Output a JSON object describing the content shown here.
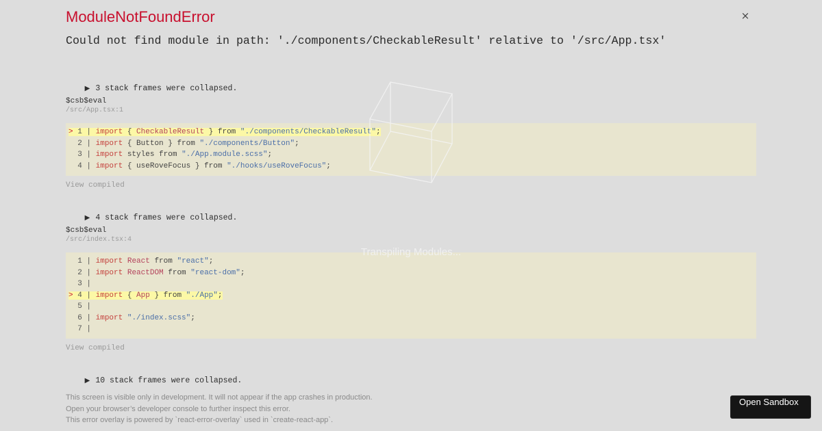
{
  "error": {
    "title": "ModuleNotFoundError",
    "close_label": "×",
    "message": "Could not find module in path: './components/CheckableResult' relative to '/src/App.tsx'"
  },
  "stack": {
    "collapsed_1": "3 stack frames were collapsed.",
    "collapsed_2": "4 stack frames were collapsed.",
    "collapsed_3": "10 stack frames were collapsed.",
    "collapse_icon": "triangle-right-icon",
    "frames": [
      {
        "function": "$csb$eval",
        "location": "/src/App.tsx:1",
        "view_compiled": "View compiled",
        "lines": [
          {
            "marker": ">",
            "num": "1",
            "highlight": true,
            "tokens": [
              [
                "kw",
                "import"
              ],
              [
                "plain",
                " { "
              ],
              [
                "id",
                "CheckableResult"
              ],
              [
                "plain",
                " } from "
              ],
              [
                "str",
                "\"./components/CheckableResult\""
              ],
              [
                "plain",
                ";"
              ]
            ]
          },
          {
            "marker": " ",
            "num": "2",
            "highlight": false,
            "tokens": [
              [
                "kw",
                "import"
              ],
              [
                "plain",
                " { Button } from "
              ],
              [
                "str",
                "\"./components/Button\""
              ],
              [
                "plain",
                ";"
              ]
            ]
          },
          {
            "marker": " ",
            "num": "3",
            "highlight": false,
            "tokens": [
              [
                "kw",
                "import"
              ],
              [
                "plain",
                " styles from "
              ],
              [
                "str",
                "\"./App.module.scss\""
              ],
              [
                "plain",
                ";"
              ]
            ]
          },
          {
            "marker": " ",
            "num": "4",
            "highlight": false,
            "tokens": [
              [
                "kw",
                "import"
              ],
              [
                "plain",
                " { useRoveFocus } from "
              ],
              [
                "str",
                "\"./hooks/useRoveFocus\""
              ],
              [
                "plain",
                ";"
              ]
            ]
          }
        ]
      },
      {
        "function": "$csb$eval",
        "location": "/src/index.tsx:4",
        "view_compiled": "View compiled",
        "lines": [
          {
            "marker": " ",
            "num": "1",
            "highlight": false,
            "tokens": [
              [
                "kw",
                "import"
              ],
              [
                "plain",
                " "
              ],
              [
                "id",
                "React"
              ],
              [
                "plain",
                " from "
              ],
              [
                "str",
                "\"react\""
              ],
              [
                "plain",
                ";"
              ]
            ]
          },
          {
            "marker": " ",
            "num": "2",
            "highlight": false,
            "tokens": [
              [
                "kw",
                "import"
              ],
              [
                "plain",
                " "
              ],
              [
                "id",
                "ReactDOM"
              ],
              [
                "plain",
                " from "
              ],
              [
                "str",
                "\"react-dom\""
              ],
              [
                "plain",
                ";"
              ]
            ]
          },
          {
            "marker": " ",
            "num": "3",
            "highlight": false,
            "tokens": []
          },
          {
            "marker": ">",
            "num": "4",
            "highlight": true,
            "tokens": [
              [
                "kw",
                "import"
              ],
              [
                "plain",
                " { "
              ],
              [
                "id",
                "App"
              ],
              [
                "plain",
                " } from "
              ],
              [
                "str",
                "\"./App\""
              ],
              [
                "plain",
                ";"
              ]
            ]
          },
          {
            "marker": " ",
            "num": "5",
            "highlight": false,
            "tokens": []
          },
          {
            "marker": " ",
            "num": "6",
            "highlight": false,
            "tokens": [
              [
                "kw",
                "import"
              ],
              [
                "plain",
                " "
              ],
              [
                "str",
                "\"./index.scss\""
              ],
              [
                "plain",
                ";"
              ]
            ]
          },
          {
            "marker": " ",
            "num": "7",
            "highlight": false,
            "tokens": []
          }
        ]
      }
    ]
  },
  "footer": {
    "line1": "This screen is visible only in development. It will not appear if the app crashes in production.",
    "line2": "Open your browser’s developer console to further inspect this error.",
    "line3": "This error overlay is powered by `react-error-overlay` used in `create-react-app`."
  },
  "loader": {
    "text": "Transpiling Modules...",
    "icon": "cube-loader-icon"
  },
  "sandbox_button": {
    "label": "Open Sandbox"
  },
  "colors": {
    "error_red": "#c8102e",
    "code_bg": "#e8e5cf",
    "highlight_bg": "#fcf8a6",
    "background": "#dddddd"
  }
}
